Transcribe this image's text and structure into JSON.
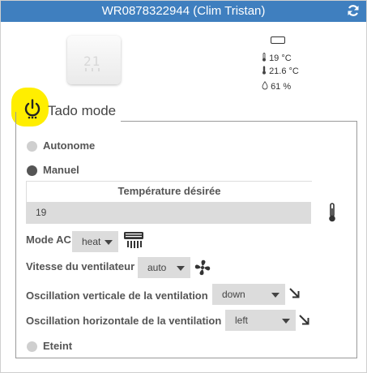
{
  "header": {
    "title": "WR0878322944 (Clim Tristan)",
    "refresh_icon": "refresh-icon",
    "bg_color": "#3f7fbf"
  },
  "device": {
    "display_digits": "21",
    "icon": "thermostat-device-image"
  },
  "status": {
    "battery_icon": "battery-icon",
    "target_temp": "19 °C",
    "current_temp": "21.6 °C",
    "humidity": "61 %"
  },
  "mode_section": {
    "title": "Tado mode",
    "icon": "power-icon",
    "highlight_color": "#ffee00"
  },
  "modes": {
    "autonome": "Autonome",
    "manuel": "Manuel",
    "eteint": "Eteint",
    "selected": "Manuel"
  },
  "manual": {
    "temperature_label": "Température désirée",
    "temperature_value": "19",
    "mode_ac_label": "Mode AC",
    "mode_ac_value": "heat",
    "fan_speed_label": "Vitesse du ventilateur",
    "fan_speed_value": "auto",
    "swing_vertical_label": "Oscillation verticale de la ventilation",
    "swing_vertical_value": "down",
    "swing_horizontal_label": "Oscillation horizontale de la ventilation",
    "swing_horizontal_value": "left"
  }
}
